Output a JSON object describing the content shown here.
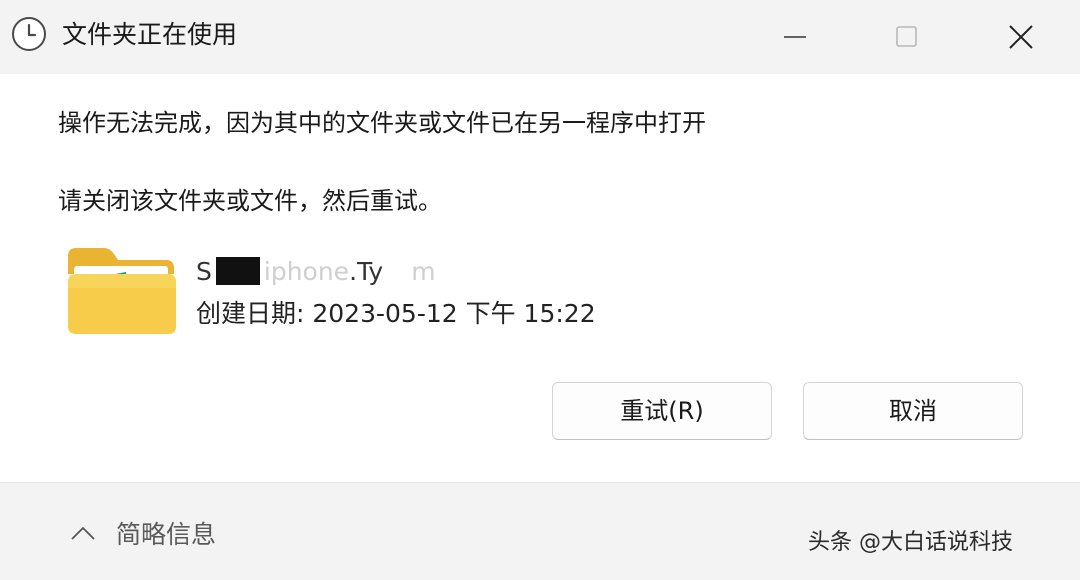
{
  "window": {
    "title": "文件夹正在使用",
    "icon": "clock-icon",
    "controls": [
      "minimize-icon",
      "maximize-icon",
      "close-icon"
    ]
  },
  "message": {
    "line1": "操作无法完成，因为其中的文件夹或文件已在另一程序中打开",
    "line2": "请关闭该文件夹或文件，然后重试。"
  },
  "file": {
    "icon": "folder-icon",
    "name_prefix": "S",
    "name_middle": "iphone",
    "name_suffix": ".Ty",
    "name_tail": "m",
    "created": "创建日期: 2023-05-12 下午 15:22"
  },
  "buttons": {
    "retry": "重试(R)",
    "cancel": "取消"
  },
  "footer": {
    "details": "简略信息",
    "watermark": "头条 @大白话说科技"
  },
  "colors": {
    "background": "#f3f3f3",
    "content": "#ffffff",
    "folder": "#f5c542"
  }
}
